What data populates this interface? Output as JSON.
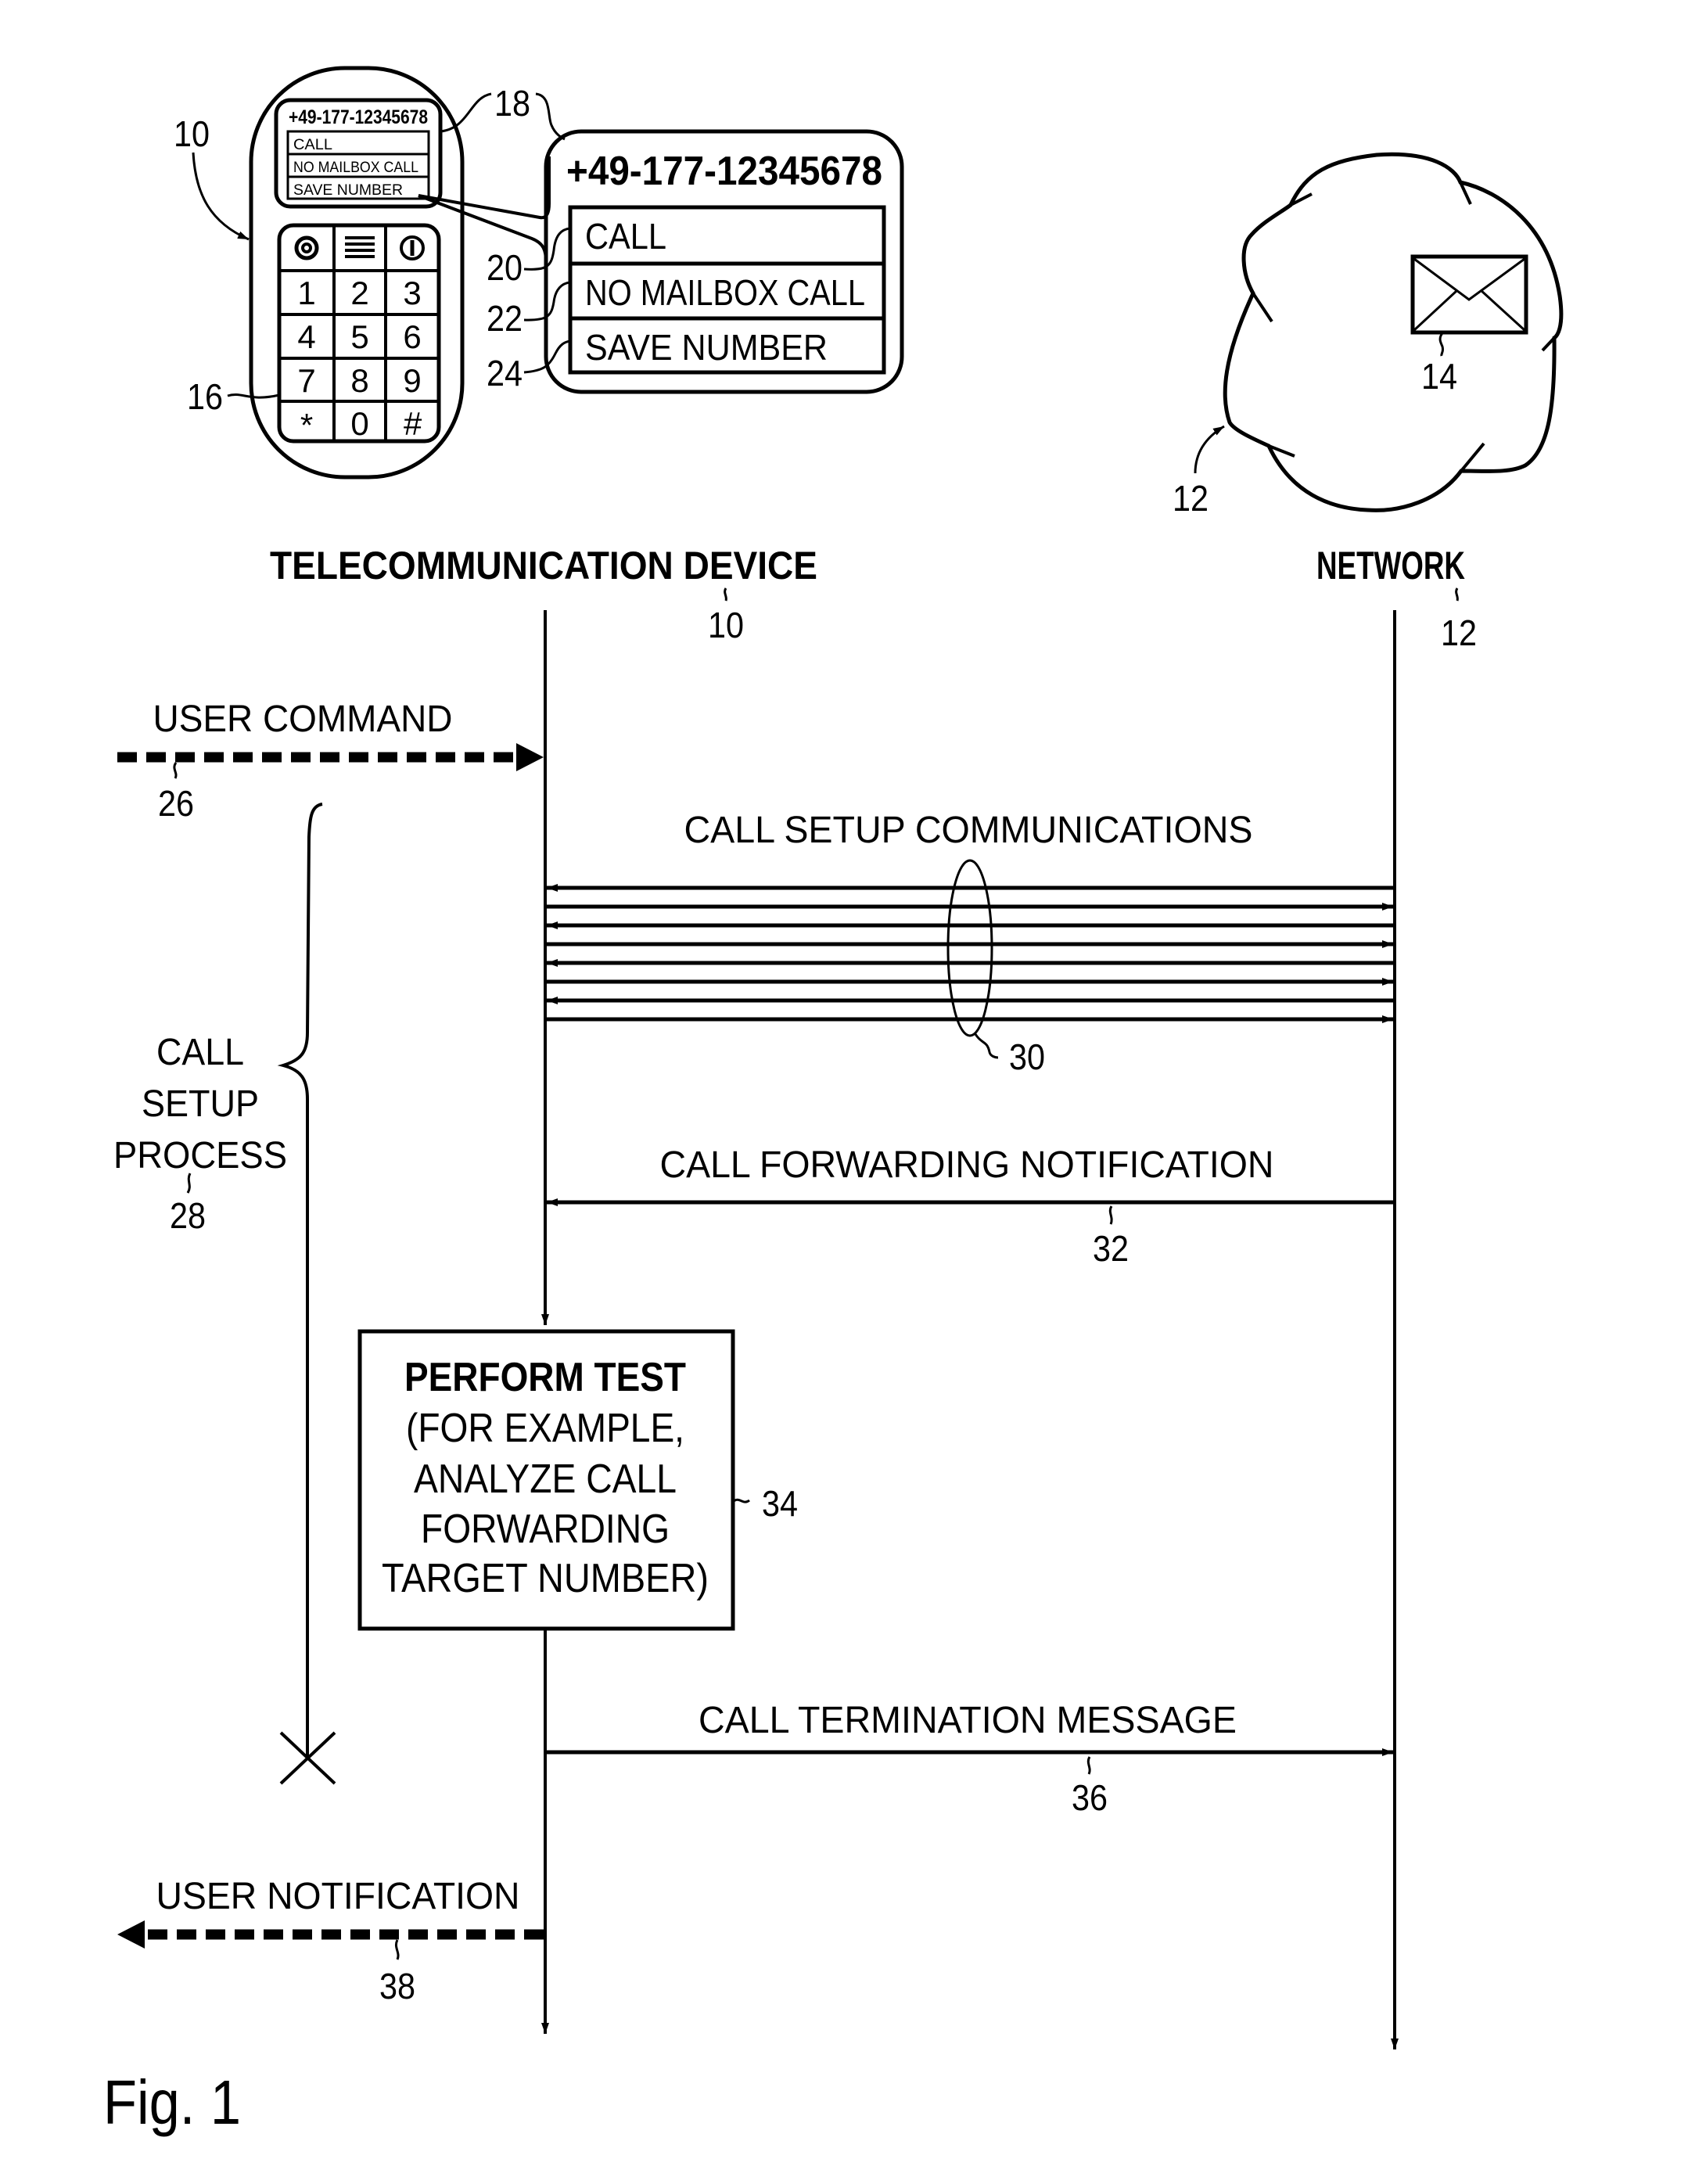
{
  "figure": {
    "caption": "Fig. 1",
    "ink_color": "#000000",
    "background_color": "#ffffff"
  },
  "device": {
    "ref": "10",
    "keypad_ref": "16",
    "screen_ref": "18",
    "screen": {
      "number": "+49-177-12345678",
      "menu": [
        "CALL",
        "NO MAILBOX CALL",
        "SAVE NUMBER"
      ]
    },
    "keypad": {
      "function_keys": [
        "camera-icon",
        "menu-icon",
        "power-icon"
      ],
      "keys": [
        "1",
        "2",
        "3",
        "4",
        "5",
        "6",
        "7",
        "8",
        "9",
        "*",
        "0",
        "#"
      ]
    },
    "callout": {
      "number": "+49-177-12345678",
      "items": [
        {
          "label": "CALL",
          "ref": "20"
        },
        {
          "label": "NO MAILBOX CALL",
          "ref": "22"
        },
        {
          "label": "SAVE NUMBER",
          "ref": "24"
        }
      ]
    }
  },
  "network": {
    "ref": "12",
    "mailbox_ref": "14",
    "mailbox_icon": "envelope-icon"
  },
  "lifelines": {
    "device_label": "TELECOMMUNICATION DEVICE",
    "device_ref": "10",
    "network_label": "NETWORK",
    "network_ref": "12"
  },
  "messages": {
    "user_command": {
      "label": "USER COMMAND",
      "ref": "26"
    },
    "call_setup": {
      "label": "CALL SETUP COMMUNICATIONS",
      "ref": "30",
      "arrow_directions": [
        "left",
        "right",
        "left",
        "right",
        "left",
        "right",
        "left",
        "right"
      ]
    },
    "call_forwarding": {
      "label": "CALL FORWARDING NOTIFICATION",
      "ref": "32"
    },
    "call_termination": {
      "label": "CALL TERMINATION MESSAGE",
      "ref": "36"
    },
    "user_notification": {
      "label": "USER NOTIFICATION",
      "ref": "38"
    }
  },
  "process": {
    "label_lines": [
      "CALL",
      "SETUP",
      "PROCESS"
    ],
    "ref": "28"
  },
  "test_box": {
    "title": "PERFORM TEST",
    "lines": [
      "(FOR EXAMPLE,",
      "ANALYZE CALL",
      "FORWARDING",
      "TARGET NUMBER)"
    ],
    "ref": "34"
  }
}
